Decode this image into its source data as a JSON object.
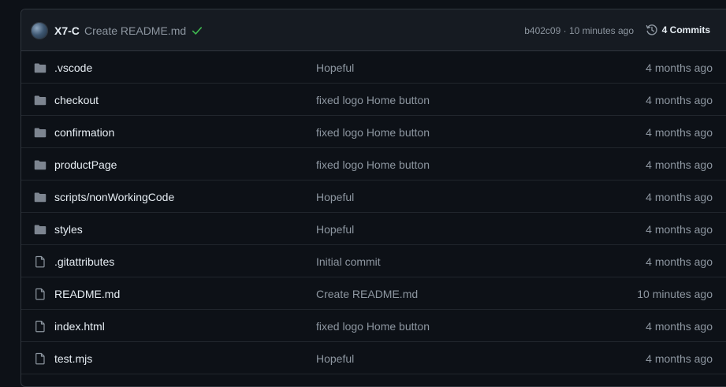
{
  "commit": {
    "author": "X7-C",
    "message": "Create README.md",
    "sha": "b402c09",
    "separator": " · ",
    "time": "10 minutes ago",
    "commits_count": "4 Commits"
  },
  "files": [
    {
      "name": ".vscode",
      "type": "folder",
      "message": "Hopeful",
      "age": "4 months ago"
    },
    {
      "name": "checkout",
      "type": "folder",
      "message": "fixed logo Home button",
      "age": "4 months ago"
    },
    {
      "name": "confirmation",
      "type": "folder",
      "message": "fixed logo Home button",
      "age": "4 months ago"
    },
    {
      "name": "productPage",
      "type": "folder",
      "message": "fixed logo Home button",
      "age": "4 months ago"
    },
    {
      "name": "scripts/nonWorkingCode",
      "type": "folder",
      "message": "Hopeful",
      "age": "4 months ago"
    },
    {
      "name": "styles",
      "type": "folder",
      "message": "Hopeful",
      "age": "4 months ago"
    },
    {
      "name": ".gitattributes",
      "type": "file",
      "message": "Initial commit",
      "age": "4 months ago"
    },
    {
      "name": "README.md",
      "type": "file",
      "message": "Create README.md",
      "age": "10 minutes ago"
    },
    {
      "name": "index.html",
      "type": "file",
      "message": "fixed logo Home button",
      "age": "4 months ago"
    },
    {
      "name": "test.mjs",
      "type": "file",
      "message": "Hopeful",
      "age": "4 months ago"
    }
  ],
  "icons": {
    "folder": "folder-icon",
    "file": "file-icon",
    "check": "check-icon",
    "history": "history-icon"
  },
  "colors": {
    "background": "#0d1117",
    "header_bg": "#161b22",
    "border": "#30363d",
    "row_border": "#21262d",
    "text": "#e6edf3",
    "muted": "#8d96a0",
    "success": "#3fb950",
    "folder": "#7d8590"
  }
}
